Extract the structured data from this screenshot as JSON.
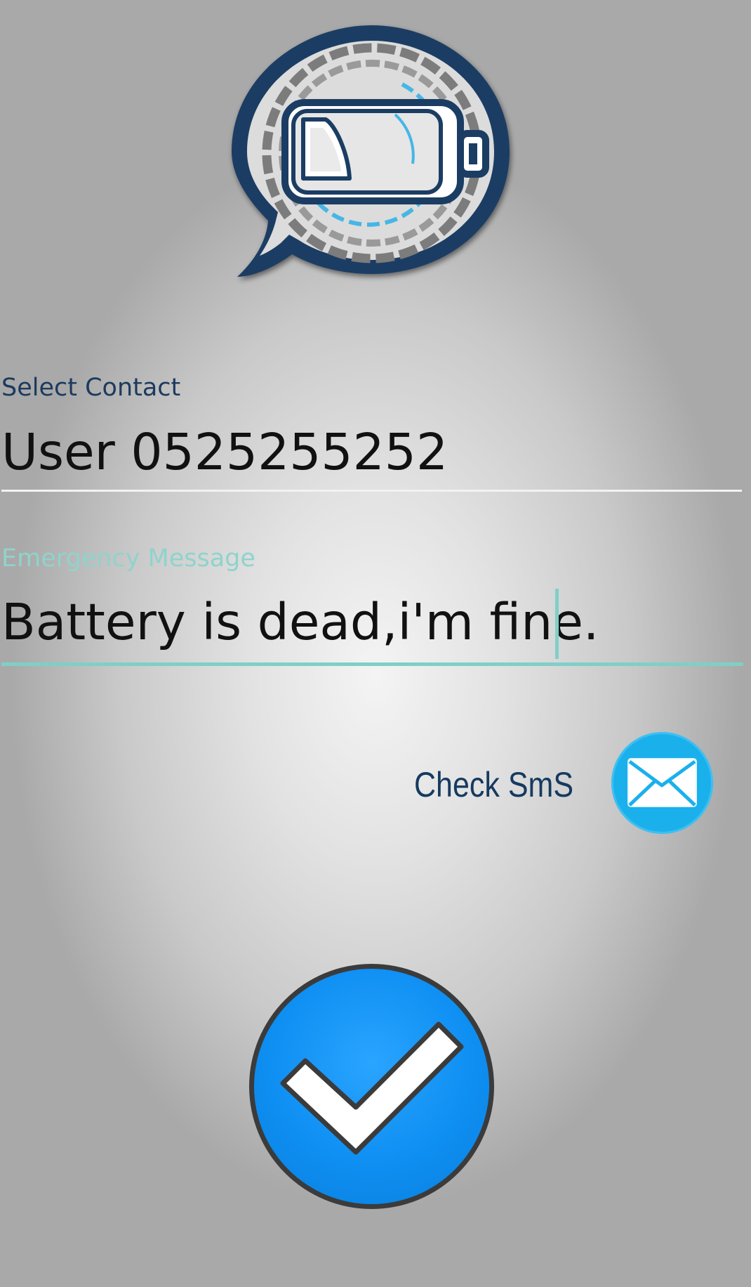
{
  "app": {
    "logo_icon": "battery-chat-bubble-icon"
  },
  "contact": {
    "label": "Select Contact",
    "value": "User  0525255252"
  },
  "message": {
    "label": "Emergency Message",
    "value": "Battery is dead,i'm fine."
  },
  "check_sms": {
    "label": "Check SmS",
    "icon": "envelope-icon"
  },
  "confirm": {
    "icon": "checkmark-icon"
  },
  "colors": {
    "navy": "#163a60",
    "teal_accent": "#7fcfc7",
    "sms_blue": "#1ab0ec",
    "confirm_blue": "#0e8ff2"
  }
}
